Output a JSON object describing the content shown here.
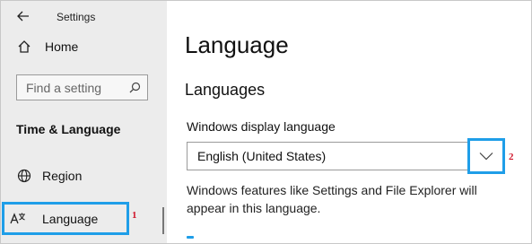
{
  "app": {
    "title": "Settings"
  },
  "sidebar": {
    "home_label": "Home",
    "search": {
      "placeholder": "Find a setting"
    },
    "section": "Time & Language",
    "items": [
      {
        "label": "Region",
        "icon": "globe-icon"
      },
      {
        "label": "Language",
        "icon": "language-icon",
        "selected": true,
        "callout": "1"
      }
    ]
  },
  "main": {
    "title": "Language",
    "subtitle": "Languages",
    "display_language": {
      "label": "Windows display language",
      "value": "English (United States)",
      "callout": "2"
    },
    "description": "Windows features like Settings and File Explorer will appear in this language."
  },
  "colors": {
    "highlight": "#1f9ee8",
    "callout": "#d0162b",
    "sidebar_bg": "#ececec"
  }
}
